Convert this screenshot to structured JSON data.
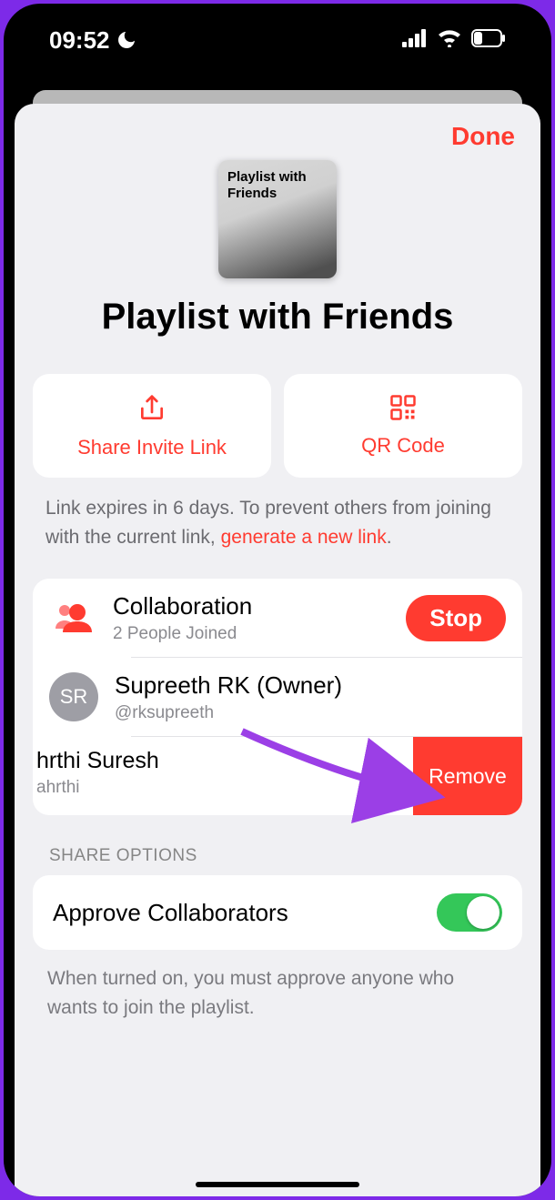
{
  "status": {
    "time": "09:52"
  },
  "sheet": {
    "done": "Done",
    "cover_text": "Playlist with Friends",
    "title": "Playlist with Friends",
    "share_card": "Share Invite Link",
    "qr_card": "QR Code",
    "expire_prefix": "Link expires in 6 days. To prevent others from joining with the current link, ",
    "generate_link": "generate a new link",
    "expire_suffix": "."
  },
  "collab": {
    "title": "Collaboration",
    "subtitle": "2 People Joined",
    "stop": "Stop"
  },
  "owner": {
    "initials": "SR",
    "name": "Supreeth RK (Owner)",
    "handle": "@rksupreeth"
  },
  "member": {
    "name": "hrthi Suresh",
    "handle": "ahrthi",
    "remove": "Remove"
  },
  "options": {
    "header": "SHARE OPTIONS",
    "approve": "Approve Collaborators",
    "note": "When turned on, you must approve anyone who wants to join the playlist."
  }
}
